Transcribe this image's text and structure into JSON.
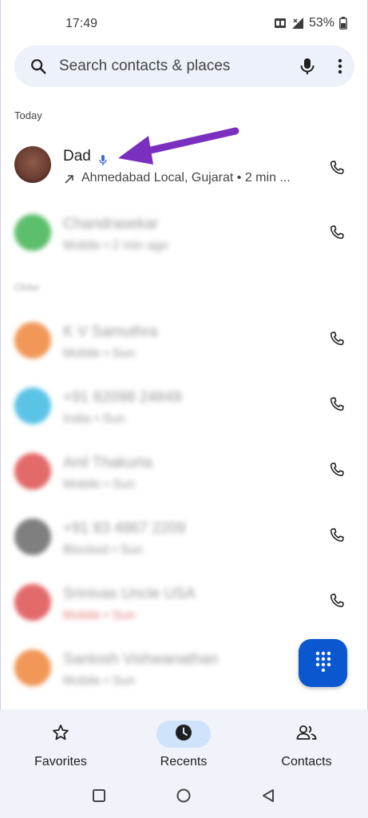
{
  "status_bar": {
    "time": "17:49",
    "battery": "53%",
    "network": "VoLTE"
  },
  "search": {
    "placeholder": "Search contacts & places"
  },
  "sections": {
    "today": "Today",
    "older": "Older"
  },
  "calls": [
    {
      "name": "Dad",
      "detail": "Ahmedabad Local, Gujarat • 2 min ...",
      "avatar_color": "#7a4a3e",
      "has_voice_note": true,
      "direction": "outgoing"
    },
    {
      "name": "Chandrasekar",
      "detail": "Mobile • 2 min ago",
      "avatar_color": "#5cbf6b"
    },
    {
      "name": "K V Samuthra",
      "detail": "Mobile • Sun",
      "avatar_color": "#f19858"
    },
    {
      "name": "+91 82098 24849",
      "detail": "India • Sun",
      "avatar_color": "#5bc4e6"
    },
    {
      "name": "Anil Thakurta",
      "detail": "Mobile • Sun",
      "avatar_color": "#e36a6a"
    },
    {
      "name": "+91 83 4867 2209",
      "detail": "Blocked • Sun",
      "avatar_color": "#7f7f7f"
    },
    {
      "name": "Srinivas Uncle USA",
      "detail": "Mobile • Sun",
      "avatar_color": "#e36a6a",
      "missed": true
    },
    {
      "name": "Santosh Vishwanathan",
      "detail": "Mobile • Sun",
      "avatar_color": "#f19858"
    }
  ],
  "bottom_nav": {
    "favorites": "Favorites",
    "recents": "Recents",
    "contacts": "Contacts"
  },
  "colors": {
    "accent": "#0b57d0",
    "annotation": "#7b2fbe",
    "search_bg": "#edf1f9",
    "nav_active_pill": "#cfe3fb"
  }
}
